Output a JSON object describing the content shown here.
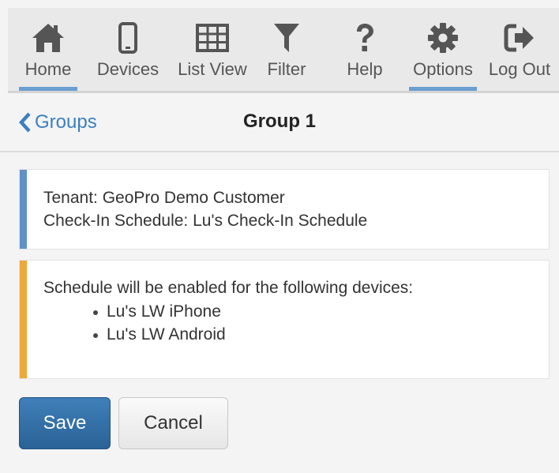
{
  "nav": {
    "items": [
      {
        "label": "Home",
        "icon": "home-icon",
        "active": true
      },
      {
        "label": "Devices",
        "icon": "phone-icon",
        "active": false
      },
      {
        "label": "List View",
        "icon": "grid-icon",
        "active": false
      },
      {
        "label": "Filter",
        "icon": "filter-icon",
        "active": false
      },
      {
        "label": "Help",
        "icon": "question-icon",
        "active": false
      },
      {
        "label": "Options",
        "icon": "gear-icon",
        "active": true
      },
      {
        "label": "Log Out",
        "icon": "logout-icon",
        "active": false
      }
    ],
    "icon_color": "#555555",
    "underline_color": "#6a9fd0"
  },
  "header": {
    "back_label": "Groups",
    "title": "Group 1"
  },
  "info_card": {
    "tenant_line": "Tenant: GeoPro Demo Customer",
    "schedule_line": "Check-In Schedule: Lu's Check-In Schedule",
    "accent_color": "#5f93c8"
  },
  "devices_card": {
    "intro": "Schedule will be enabled for the following devices:",
    "devices": [
      "Lu's LW iPhone",
      "Lu's LW Android"
    ],
    "accent_color": "#efa93a"
  },
  "actions": {
    "save_label": "Save",
    "cancel_label": "Cancel"
  }
}
